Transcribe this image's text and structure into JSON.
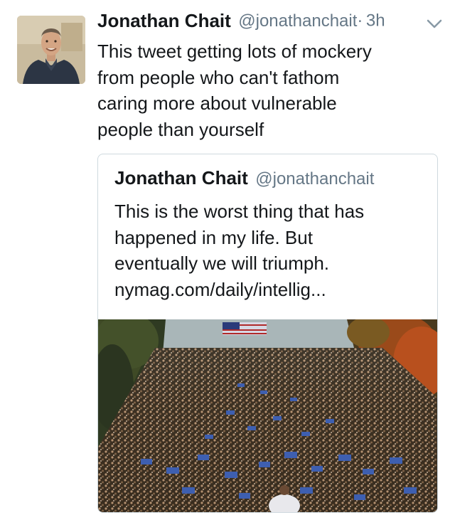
{
  "tweet": {
    "author_name": "Jonathan Chait",
    "author_handle": "@jonathanchait",
    "separator": "·",
    "timestamp": "3h",
    "text": "This tweet getting lots of mockery\nfrom people who can't fathom\ncaring more about vulnerable\npeople than yourself",
    "avatar_icon": "profile-photo",
    "menu_icon": "chevron-down-icon"
  },
  "quoted_tweet": {
    "author_name": "Jonathan Chait",
    "author_handle": "@jonathanchait",
    "text": "This is the worst thing that has\nhappened in my life. But\neventually we will triumph.",
    "link": "nymag.com/daily/intellig..."
  },
  "colors": {
    "text": "#14171a",
    "secondary": "#657786",
    "border": "#cfd9de"
  }
}
